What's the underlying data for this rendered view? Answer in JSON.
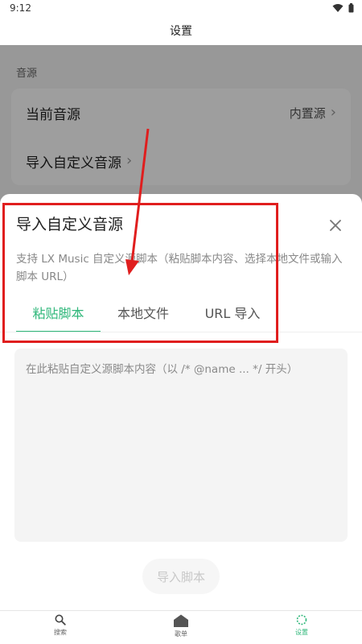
{
  "status_bar": {
    "time": "9:12",
    "icons": [
      "wifi-icon",
      "battery-icon"
    ]
  },
  "header": {
    "title": "设置"
  },
  "settings": {
    "section_title": "音源",
    "rows": [
      {
        "label": "当前音源",
        "value": "内置源"
      },
      {
        "label": "导入自定义音源"
      }
    ]
  },
  "sheet": {
    "title": "导入自定义音源",
    "close_icon": "close-icon",
    "description": "支持 LX Music 自定义源脚本（粘贴脚本内容、选择本地文件或输入脚本 URL）",
    "tabs": [
      {
        "label": "粘贴脚本",
        "active": true
      },
      {
        "label": "本地文件",
        "active": false
      },
      {
        "label": "URL 导入",
        "active": false
      }
    ],
    "paste": {
      "placeholder": "在此粘贴自定义源脚本内容（以 /* @name ... */ 开头）",
      "value": ""
    },
    "import_button": "导入脚本"
  },
  "bottom_nav": {
    "items": [
      {
        "label": "搜索",
        "icon": "search-icon"
      },
      {
        "label": "歌单",
        "icon": "home-icon"
      },
      {
        "label": "设置",
        "icon": "settings-icon",
        "active": true
      }
    ]
  },
  "colors": {
    "accent": "#2fb77a",
    "annotation": "#e01e1e",
    "overlay": "rgba(0,0,0,0.38)"
  }
}
